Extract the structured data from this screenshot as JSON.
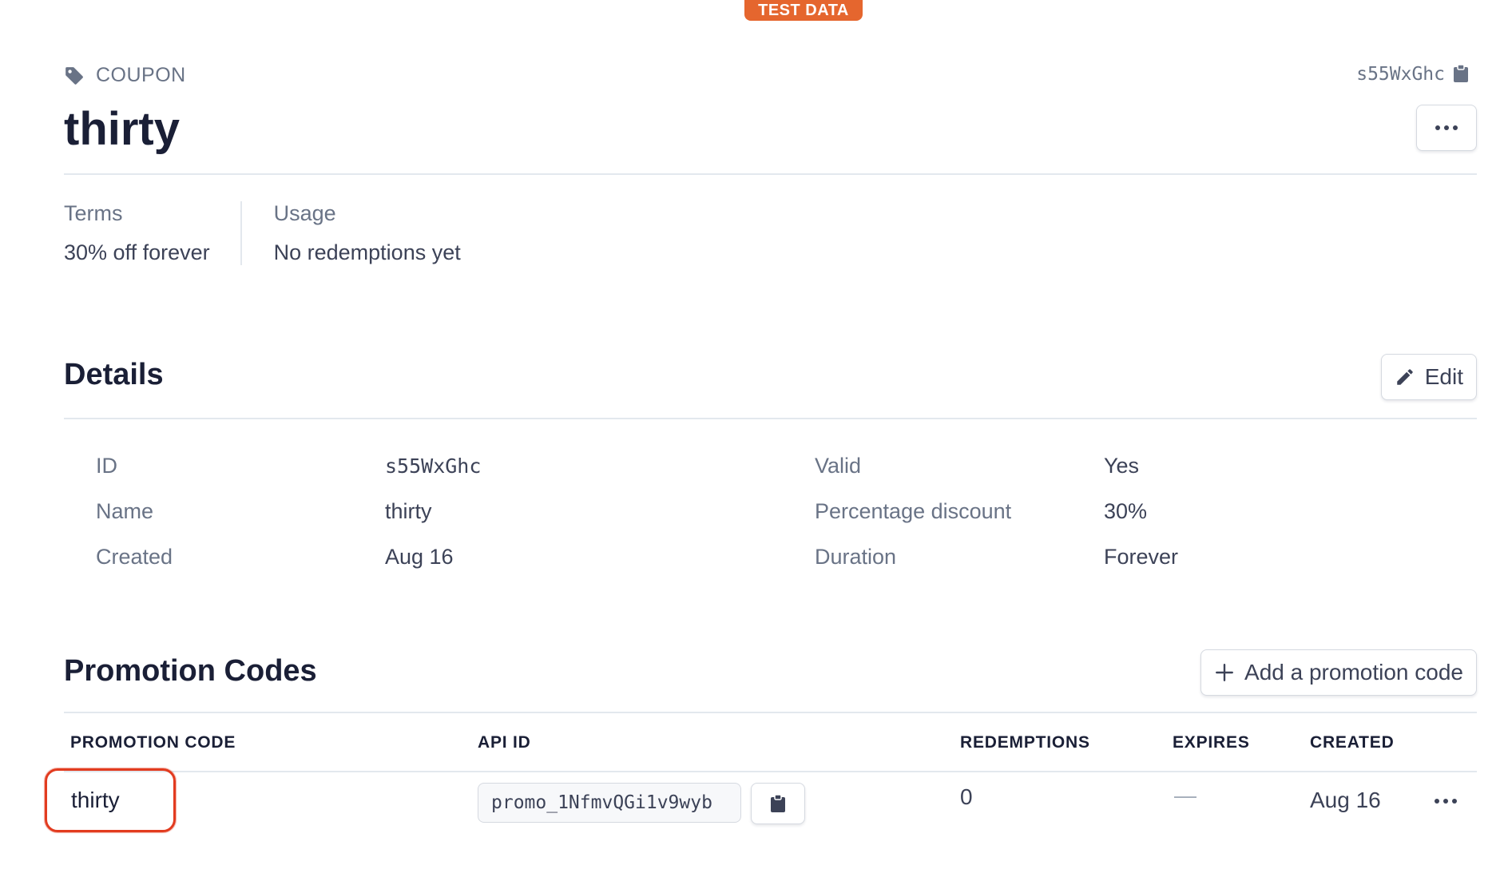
{
  "badge": "TEST DATA",
  "header": {
    "kind": "COUPON",
    "id": "s55WxGhc",
    "title": "thirty"
  },
  "summary": {
    "terms_label": "Terms",
    "terms_value": "30% off forever",
    "usage_label": "Usage",
    "usage_value": "No redemptions yet"
  },
  "details": {
    "title": "Details",
    "edit_label": "Edit",
    "rows": [
      {
        "l1": "ID",
        "v1": "s55WxGhc",
        "l2": "Valid",
        "v2": "Yes"
      },
      {
        "l1": "Name",
        "v1": "thirty",
        "l2": "Percentage discount",
        "v2": "30%"
      },
      {
        "l1": "Created",
        "v1": "Aug 16",
        "l2": "Duration",
        "v2": "Forever"
      }
    ]
  },
  "promotions": {
    "title": "Promotion Codes",
    "add_label": "Add a promotion code",
    "columns": [
      "PROMOTION CODE",
      "API ID",
      "REDEMPTIONS",
      "EXPIRES",
      "CREATED"
    ],
    "rows": [
      {
        "code": "thirty",
        "api_id": "promo_1NfmvQGi1v9wyb",
        "redemptions": "0",
        "expires": "—",
        "created": "Aug 16"
      }
    ]
  },
  "colors": {
    "badge": "#e5662e",
    "highlight": "#e23b1f",
    "text": "#1a1f36",
    "muted": "#697386"
  }
}
